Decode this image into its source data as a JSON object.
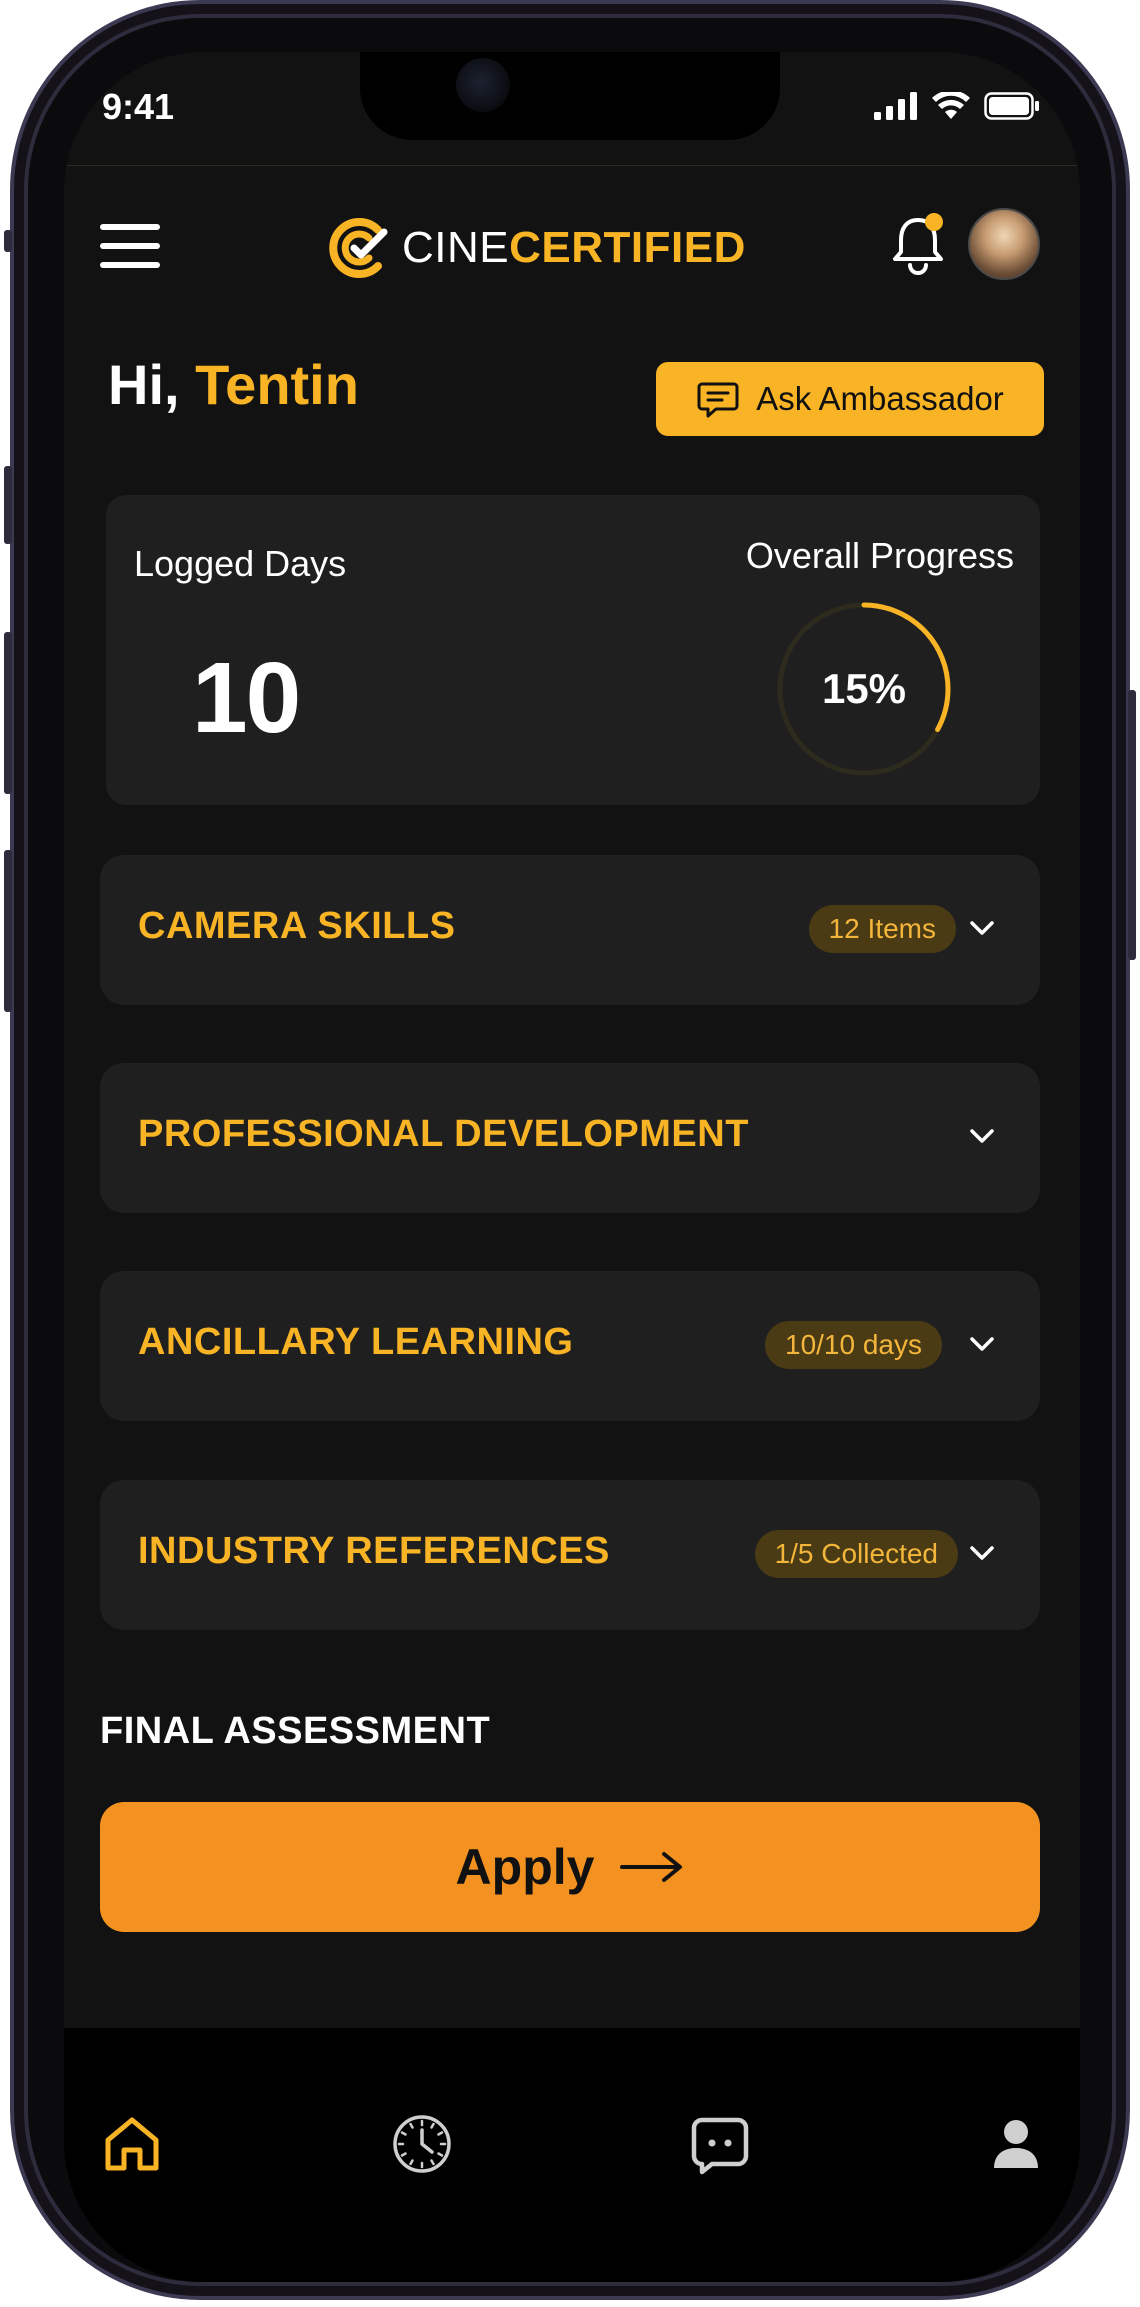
{
  "status_bar": {
    "time": "9:41"
  },
  "header": {
    "logo_part1": "CINE",
    "logo_part2": "CERTIFIED",
    "notification_dot_color": "#f8b424"
  },
  "greeting": {
    "prefix": "Hi, ",
    "name": "Tentin"
  },
  "ask_button": {
    "label": "Ask Ambassador"
  },
  "stats": {
    "logged_days_label": "Logged Days",
    "logged_days_value": "10",
    "overall_progress_label": "Overall Progress",
    "overall_progress_value": "15%",
    "overall_progress_fraction": 0.33
  },
  "sections": [
    {
      "title": "CAMERA SKILLS",
      "badge": "12 Items"
    },
    {
      "title": "PROFESSIONAL DEVELOPMENT",
      "badge": ""
    },
    {
      "title": "ANCILLARY LEARNING",
      "badge": "10/10 days"
    },
    {
      "title": "INDUSTRY REFERENCES",
      "badge": "1/5 Collected"
    }
  ],
  "final_assessment": {
    "title": "FINAL ASSESSMENT",
    "apply_label": "Apply"
  },
  "tabbar": {
    "items": [
      {
        "icon": "home-icon",
        "active": true
      },
      {
        "icon": "clock-icon",
        "active": false
      },
      {
        "icon": "chat-icon",
        "active": false
      },
      {
        "icon": "profile-icon",
        "active": false
      }
    ]
  },
  "colors": {
    "accent": "#f8b424",
    "apply_button": "#f39220",
    "card_background": "#1f1f1f",
    "screen_background": "#121212"
  }
}
